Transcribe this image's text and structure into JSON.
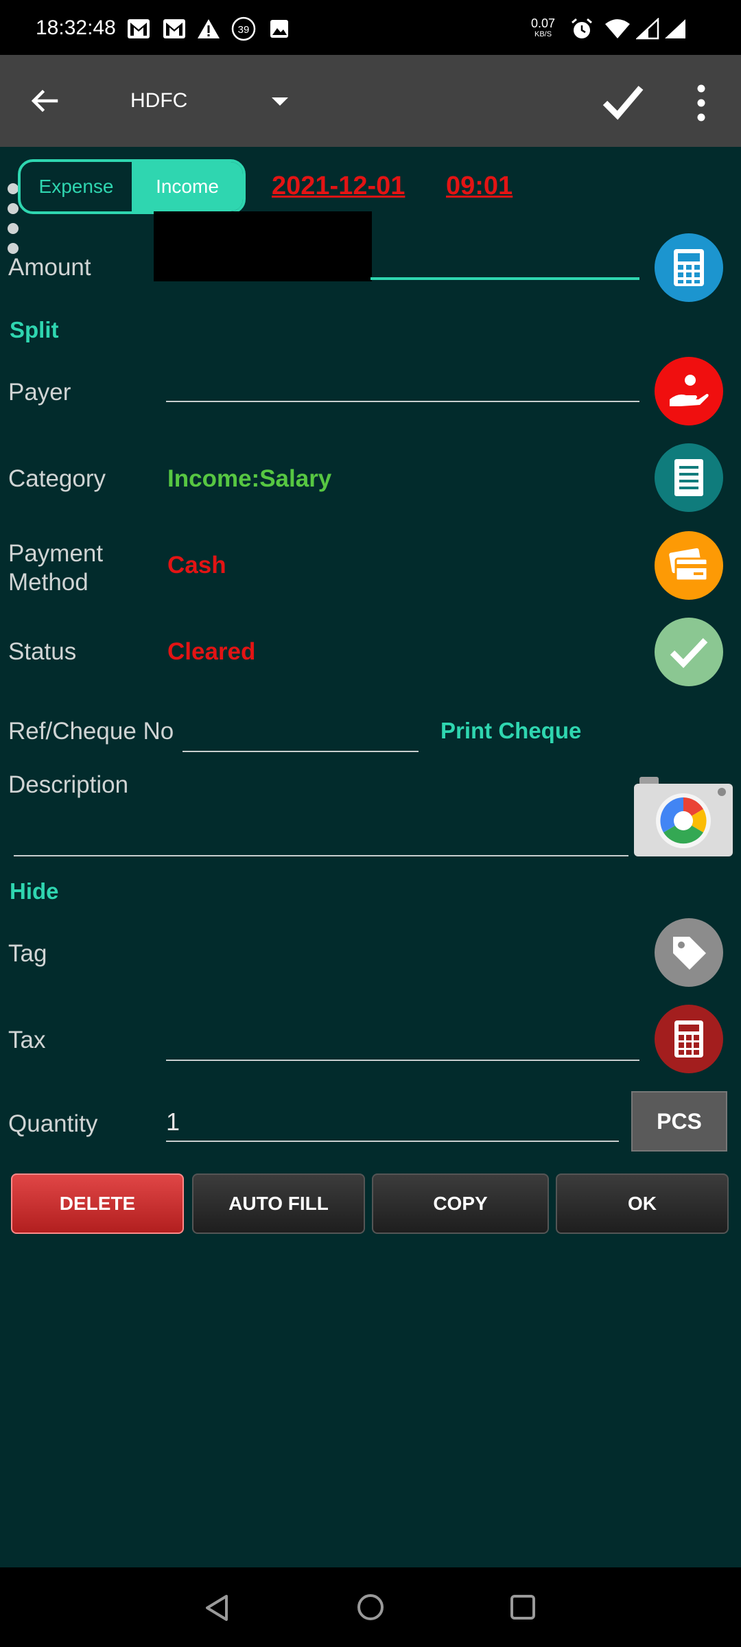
{
  "status_bar": {
    "time": "18:32:48",
    "notification_count": "39",
    "net_speed": "0.07",
    "net_unit": "KB/S",
    "icons": [
      "gmail-icon",
      "gmail-icon",
      "warning-icon",
      "badge-icon",
      "image-icon",
      "alarm-icon",
      "wifi-icon",
      "signal-icon",
      "signal-icon"
    ]
  },
  "app_bar": {
    "account": "HDFC",
    "icons": [
      "back-arrow-icon",
      "dropdown-icon",
      "checkmark-icon",
      "more-vert-icon"
    ]
  },
  "form": {
    "type_toggle": {
      "expense_label": "Expense",
      "income_label": "Income",
      "selected": "Income"
    },
    "date": "2021-12-01",
    "time": "09:01",
    "amount_label": "Amount",
    "split_label": "Split",
    "payer_label": "Payer",
    "category_label": "Category",
    "category_value": "Income:Salary",
    "payment_method_label_1": "Payment",
    "payment_method_label_2": "Method",
    "payment_method_value": "Cash",
    "status_label": "Status",
    "status_value": "Cleared",
    "ref_label": "Ref/Cheque No",
    "print_cheque": "Print Cheque",
    "description_label": "Description",
    "hide_label": "Hide",
    "tag_label": "Tag",
    "tax_label": "Tax",
    "quantity_label": "Quantity",
    "quantity_value": "1",
    "unit_label": "PCS"
  },
  "buttons": {
    "delete": "DELETE",
    "auto_fill": "AUTO FILL",
    "copy": "COPY",
    "ok": "OK"
  },
  "colors": {
    "background": "#022b2c",
    "accent": "#2fd6b0",
    "red": "#e31414",
    "category_green": "#57c742",
    "appbar": "#424242"
  }
}
